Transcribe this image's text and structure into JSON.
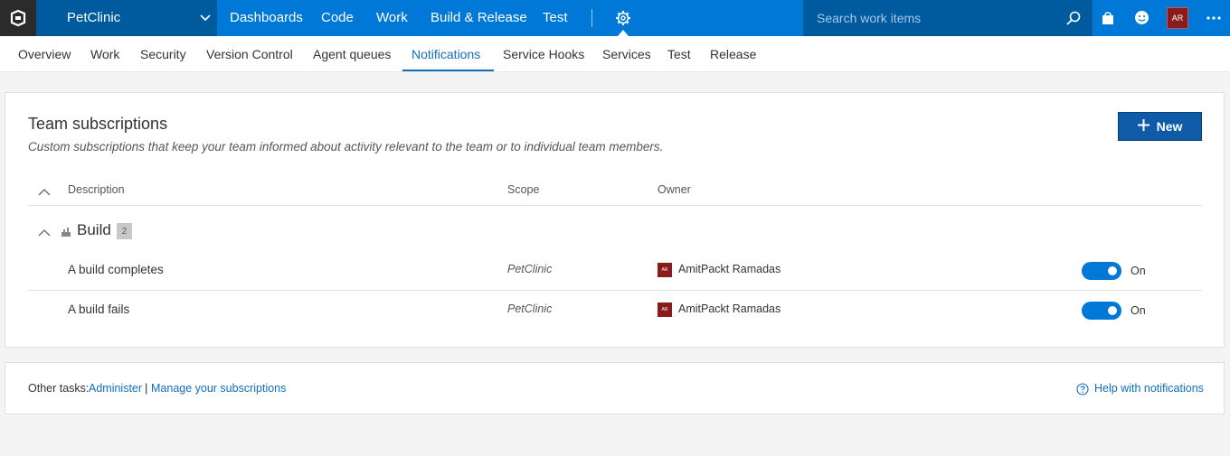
{
  "header": {
    "project": "PetClinic",
    "nav": [
      "Dashboards",
      "Code",
      "Work",
      "Build & Release",
      "Test"
    ],
    "search_placeholder": "Search work items",
    "avatar_initials": "AR",
    "brand_color": "#0078d7"
  },
  "subnav": {
    "items": [
      "Overview",
      "Work",
      "Security",
      "Version Control",
      "Agent queues",
      "Notifications",
      "Service Hooks",
      "Services",
      "Test",
      "Release"
    ],
    "active": "Notifications"
  },
  "subscriptions": {
    "title": "Team subscriptions",
    "subtitle": "Custom subscriptions that keep your team informed about activity relevant to the team or to individual team members.",
    "new_button": "New",
    "columns": {
      "description": "Description",
      "scope": "Scope",
      "owner": "Owner"
    },
    "group": {
      "name": "Build",
      "count": "2"
    },
    "rows": [
      {
        "description": "A build completes",
        "scope": "PetClinic",
        "owner_initials": "AR",
        "owner": "AmitPackt Ramadas",
        "state": "On"
      },
      {
        "description": "A build fails",
        "scope": "PetClinic",
        "owner_initials": "AR",
        "owner": "AmitPackt Ramadas",
        "state": "On"
      }
    ]
  },
  "footer": {
    "other_tasks": "Other tasks:",
    "administer": "Administer",
    "separator": "|",
    "manage": "Manage your subscriptions",
    "help": "Help with notifications"
  },
  "icons": [
    "vsts-logo-icon",
    "chevron-down-icon",
    "gear-icon",
    "search-icon",
    "shopping-bag-icon",
    "smiley-icon",
    "more-icon",
    "plus-icon",
    "chevron-up-icon",
    "build-icon",
    "help-circle-icon"
  ]
}
